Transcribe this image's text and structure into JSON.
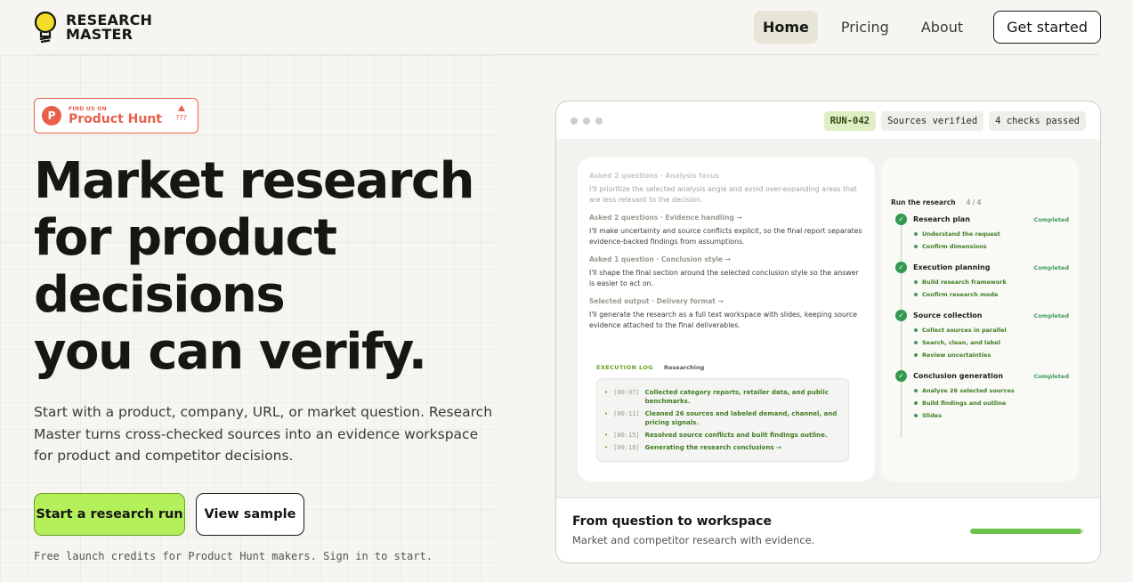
{
  "brand": {
    "line1": "RESEARCH",
    "line2": "MASTER"
  },
  "nav": {
    "links": [
      "Home",
      "Pricing",
      "About"
    ],
    "active": "Home",
    "cta": "Get started"
  },
  "badge": {
    "small": "FIND US ON",
    "name": "Product Hunt",
    "votes": "???"
  },
  "hero": {
    "line1": "Market research",
    "line2": "for product",
    "line3": "decisions",
    "line4": "you can verify.",
    "subtext": "Start with a product, company, URL, or market question. Research Master turns cross-checked sources into an evidence workspace for product and competitor decisions.",
    "primary": "Start a research run",
    "secondary": "View sample",
    "footnote": "Free launch credits for Product Hunt makers. Sign in to start."
  },
  "card": {
    "chips": {
      "run": "RUN-042",
      "sources": "Sources verified",
      "checks": "4 checks passed"
    },
    "chat": [
      {
        "q": "Asked 2 questions · Analysis focus",
        "a": "I'll prioritize the selected analysis angle and avoid over-expanding areas that are less relevant to the decision."
      },
      {
        "q": "Asked 2 questions · Evidence handling →",
        "a": "I'll make uncertainty and source conflicts explicit, so the final report separates evidence-backed findings from assumptions."
      },
      {
        "q": "Asked 1 question · Conclusion style →",
        "a": "I'll shape the final section around the selected conclusion style so the answer is easier to act on."
      },
      {
        "q": "Selected output · Delivery format →",
        "a": "I'll generate the research as a full text workspace with slides, keeping source evidence attached to the final deliverables."
      }
    ],
    "exec": {
      "title": "EXECUTION LOG",
      "status": "Researching",
      "lines": [
        {
          "time": "[00:07]",
          "msg": "Collected category reports, retailer data, and public benchmarks."
        },
        {
          "time": "[00:11]",
          "msg": "Cleaned 26 sources and labeled demand, channel, and pricing signals."
        },
        {
          "time": "[00:15]",
          "msg": "Resolved source conflicts and built findings outline."
        },
        {
          "time": "[00:18]",
          "msg": "Generating the research conclusions →"
        }
      ]
    },
    "plan": {
      "title": "Run the research",
      "count": "4 / 4",
      "steps": [
        {
          "title": "Research plan",
          "status": "Completed",
          "subs": [
            "Understand the request",
            "Confirm dimensions"
          ]
        },
        {
          "title": "Execution planning",
          "status": "Completed",
          "subs": [
            "Build research framework",
            "Confirm research mode"
          ]
        },
        {
          "title": "Source collection",
          "status": "Completed",
          "subs": [
            "Collect sources in parallel",
            "Search, clean, and label",
            "Review uncertainties"
          ]
        },
        {
          "title": "Conclusion generation",
          "status": "Completed",
          "subs": [
            "Analyze 26 selected sources",
            "Build findings and outline",
            "Slides"
          ]
        }
      ]
    },
    "footer": {
      "title": "From question to workspace",
      "sub": "Market and competitor research with evidence.",
      "progress": 0.98
    }
  },
  "colors": {
    "accent": "#b4ef5c",
    "ph": "#e8604a",
    "success": "#2f9a4f"
  }
}
